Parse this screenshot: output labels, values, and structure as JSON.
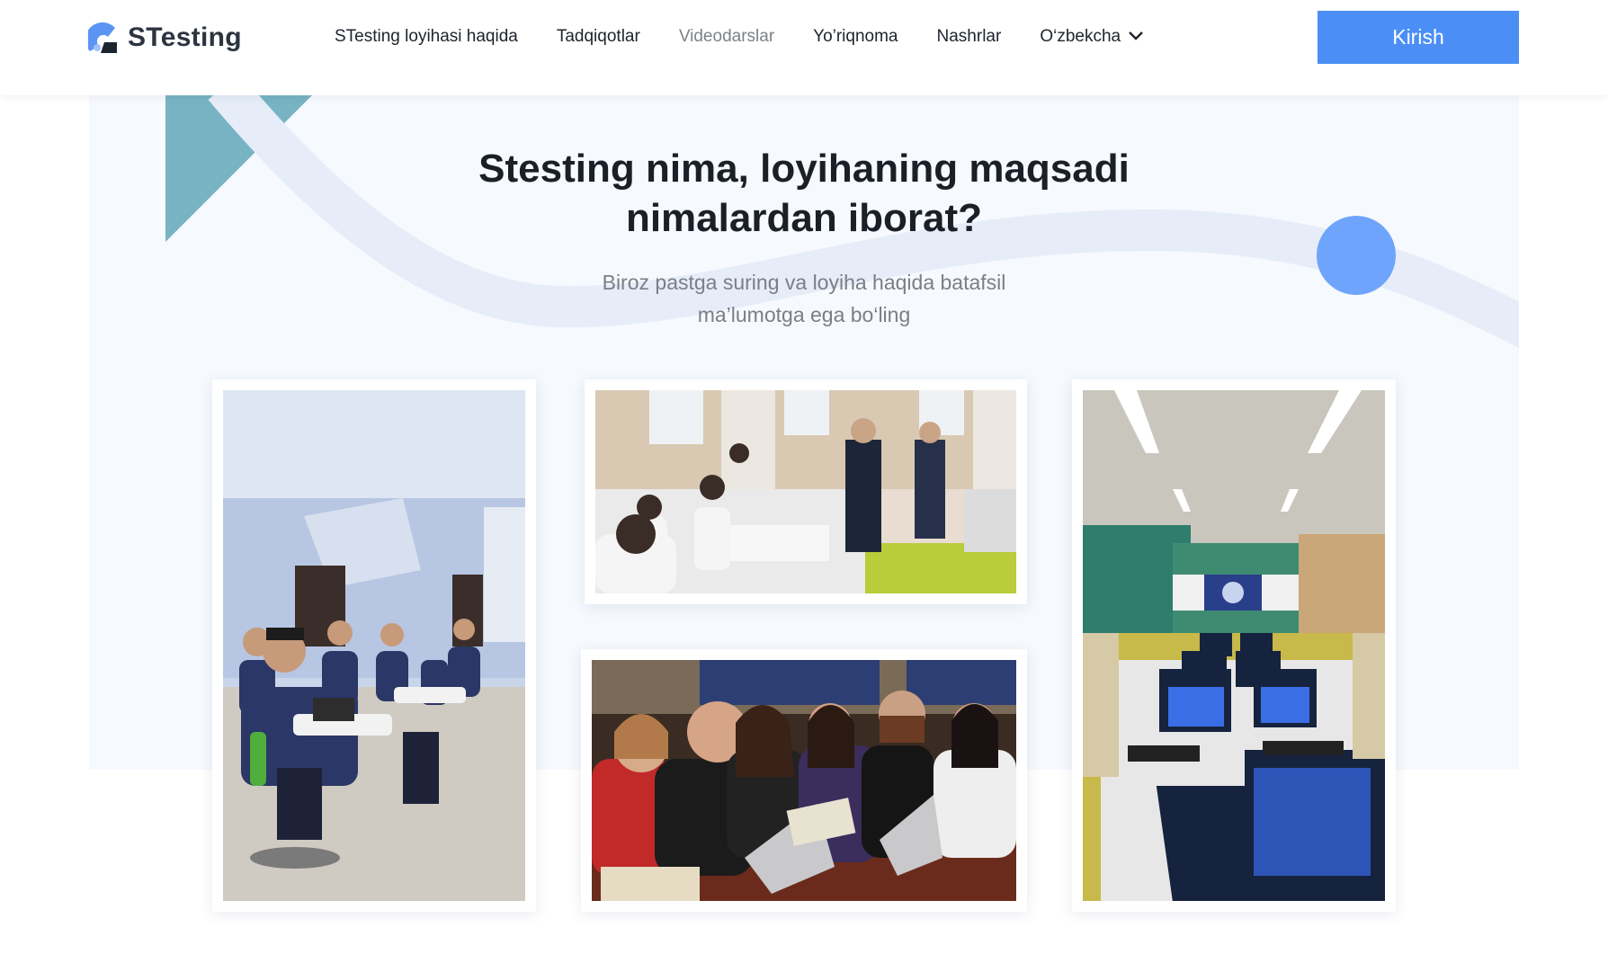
{
  "header": {
    "logo_text": "STesting",
    "nav": [
      "STesting loyihasi haqida",
      "Tadqiqotlar",
      "Videodarslar",
      "Yo’riqnoma",
      "Nashrlar"
    ],
    "language": "O‘zbekcha",
    "login_label": "Kirish"
  },
  "hero": {
    "title_line1": "Stesting nima, loyihaning maqsadi",
    "title_line2": "nimalardan iborat?",
    "subtitle_line1": "Biroz pastga suring va loyiha haqida batafsil",
    "subtitle_line2": "ma’lumotga ega bo‘ling"
  },
  "colors": {
    "accent": "#4b8ff6",
    "hero_bg": "#f6f9fe",
    "triangle": "#78b3c4",
    "circle": "#6ea4fb"
  }
}
